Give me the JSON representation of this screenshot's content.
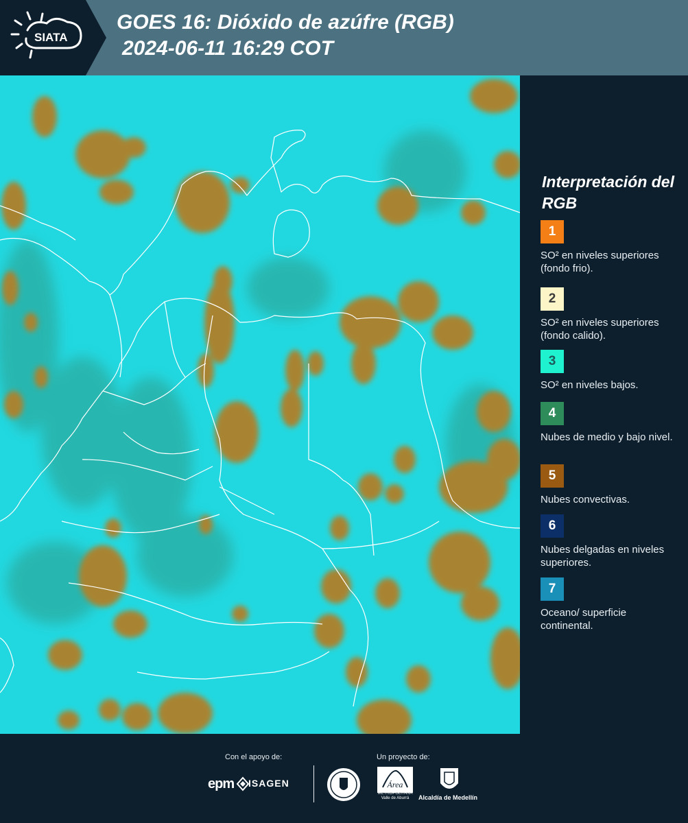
{
  "header": {
    "logo_text": "SIATA",
    "title_line1": "GOES 16: Dióxido de azúfre (RGB)",
    "title_line2": "2024-06-11 16:29 COT"
  },
  "legend": {
    "title": "Interpretación del RGB",
    "items": [
      {
        "number": "1",
        "color": "#f57f17",
        "num_color": "#ffffff",
        "text": "SO² en niveles superiores (fondo frio)."
      },
      {
        "number": "2",
        "color": "#fbf5c8",
        "num_color": "#3a3a3a",
        "text": "SO² en niveles superiores (fondo calido)."
      },
      {
        "number": "3",
        "color": "#1ff2cf",
        "num_color": "#1d5a5a",
        "text": "SO² en niveles bajos."
      },
      {
        "number": "4",
        "color": "#2e8b5a",
        "num_color": "#ffffff",
        "text": "Nubes de medio y bajo nivel."
      },
      {
        "number": "5",
        "color": "#9a5a12",
        "num_color": "#ffffff",
        "text": "Nubes convectivas."
      },
      {
        "number": "6",
        "color": "#0b2f66",
        "num_color": "#ffffff",
        "text": "Nubes delgadas en niveles superiores."
      },
      {
        "number": "7",
        "color": "#1a8fb8",
        "num_color": "#ffffff",
        "text": "Oceano/ superficie continental."
      }
    ]
  },
  "footer": {
    "support_label": "Con el apoyo de:",
    "project_label": "Un proyecto de:",
    "epm": "epm",
    "isagen": "ISAGEN",
    "area_name": "Área",
    "area_sub": "METROPOLITANA Valle de Aburrá",
    "alcaldia": "Alcaldía de Medellín"
  },
  "colors": {
    "header_bg": "#4c7180",
    "panel_bg": "#0d1f2d",
    "map_cyan": "#1fd6e0",
    "cloud_brown": "#a57f2e",
    "border_white": "#ffffff"
  }
}
